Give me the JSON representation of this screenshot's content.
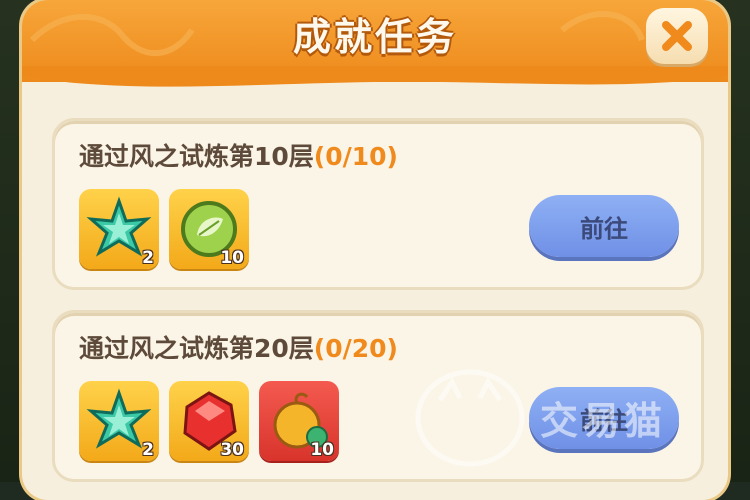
{
  "title": "成就任务",
  "tasks": [
    {
      "name": "通过风之试炼第10层",
      "progress": "(0/10)",
      "button": "前往",
      "rewards": [
        {
          "icon": "green-star-crystal-icon",
          "qty": "2"
        },
        {
          "icon": "green-leaf-orb-icon",
          "qty": "10"
        }
      ]
    },
    {
      "name": "通过风之试炼第20层",
      "progress": "(0/20)",
      "button": "前往",
      "rewards": [
        {
          "icon": "green-star-crystal-icon",
          "qty": "2"
        },
        {
          "icon": "red-gem-icon",
          "qty": "30"
        },
        {
          "icon": "golden-fruit-icon",
          "qty": "10"
        }
      ]
    }
  ],
  "watermark": "交易猫",
  "colors": {
    "header": "#f39a2c",
    "accent_progress": "#f08a1c",
    "go_button": "#7f9fee"
  }
}
